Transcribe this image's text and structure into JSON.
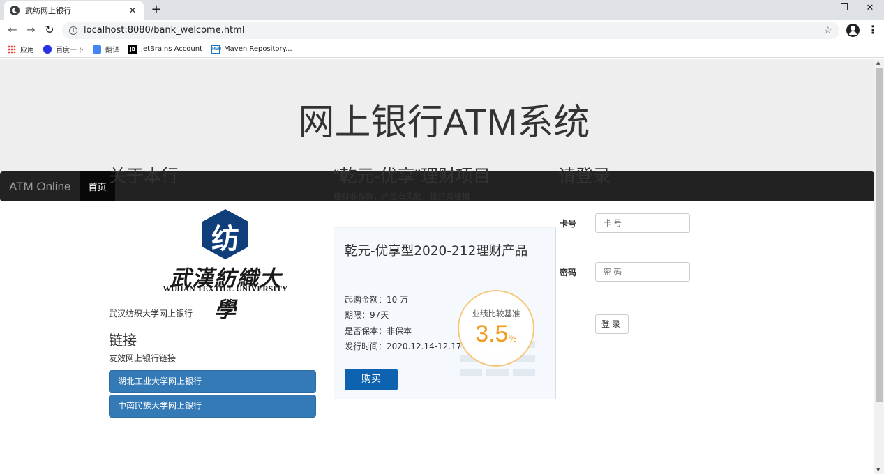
{
  "browser": {
    "tab_title": "武纺网上银行",
    "tab_close": "✕",
    "new_tab": "+",
    "window_minimize": "—",
    "window_restore": "❐",
    "window_close": "✕",
    "nav_back": "←",
    "nav_forward": "→",
    "nav_reload": "↻",
    "info_icon": "i",
    "url": "localhost:8080/bank_welcome.html",
    "star": "☆",
    "menu": "⋮",
    "bookmarks": [
      {
        "label": "应用",
        "icon": "apps-icon"
      },
      {
        "label": "百度一下",
        "icon": "baidu-icon"
      },
      {
        "label": "翻译",
        "icon": "translate-icon"
      },
      {
        "label": "JetBrains Account",
        "icon": "jetbrains-icon",
        "icon_text": "JB"
      },
      {
        "label": "Maven Repository...",
        "icon": "maven-icon",
        "icon_text": "MVN"
      }
    ]
  },
  "header": {
    "title": "网上银行ATM系统"
  },
  "navbar": {
    "brand": "ATM Online",
    "active_item": "首页"
  },
  "about": {
    "heading": "关于本行",
    "logo": {
      "glyph": "纺",
      "cn_text": "武漢紡織大學",
      "en_text": "WUHAN TEXTILE UNIVERSITY"
    },
    "caption": "武汉纺织大学网上银行",
    "links_heading": "链接",
    "links_sub": "友效网上银行链接",
    "links": [
      "湖北工业大学网上银行",
      "中南民族大学网上银行"
    ]
  },
  "product": {
    "heading": "“乾元-优享”理财项目",
    "subtitle": "理财非存款，产品有风险，投资需谨慎",
    "name": "乾元-优享型2020-212理财产品",
    "facts": [
      "起购金额：10 万",
      "期限：97天",
      "是否保本：非保本",
      "发行时间：2020.12.14-12.17"
    ],
    "rate_label": "业绩比较基准",
    "rate_value": "3.5",
    "rate_unit": "%",
    "buy_label": "购买",
    "colors": {
      "accent": "#f29c1f",
      "buy": "#0d63b0"
    }
  },
  "login": {
    "heading": "请登录",
    "card_label": "卡号",
    "card_placeholder": "卡号",
    "password_label": "密码",
    "password_placeholder": "密码",
    "submit_label": "登录"
  }
}
